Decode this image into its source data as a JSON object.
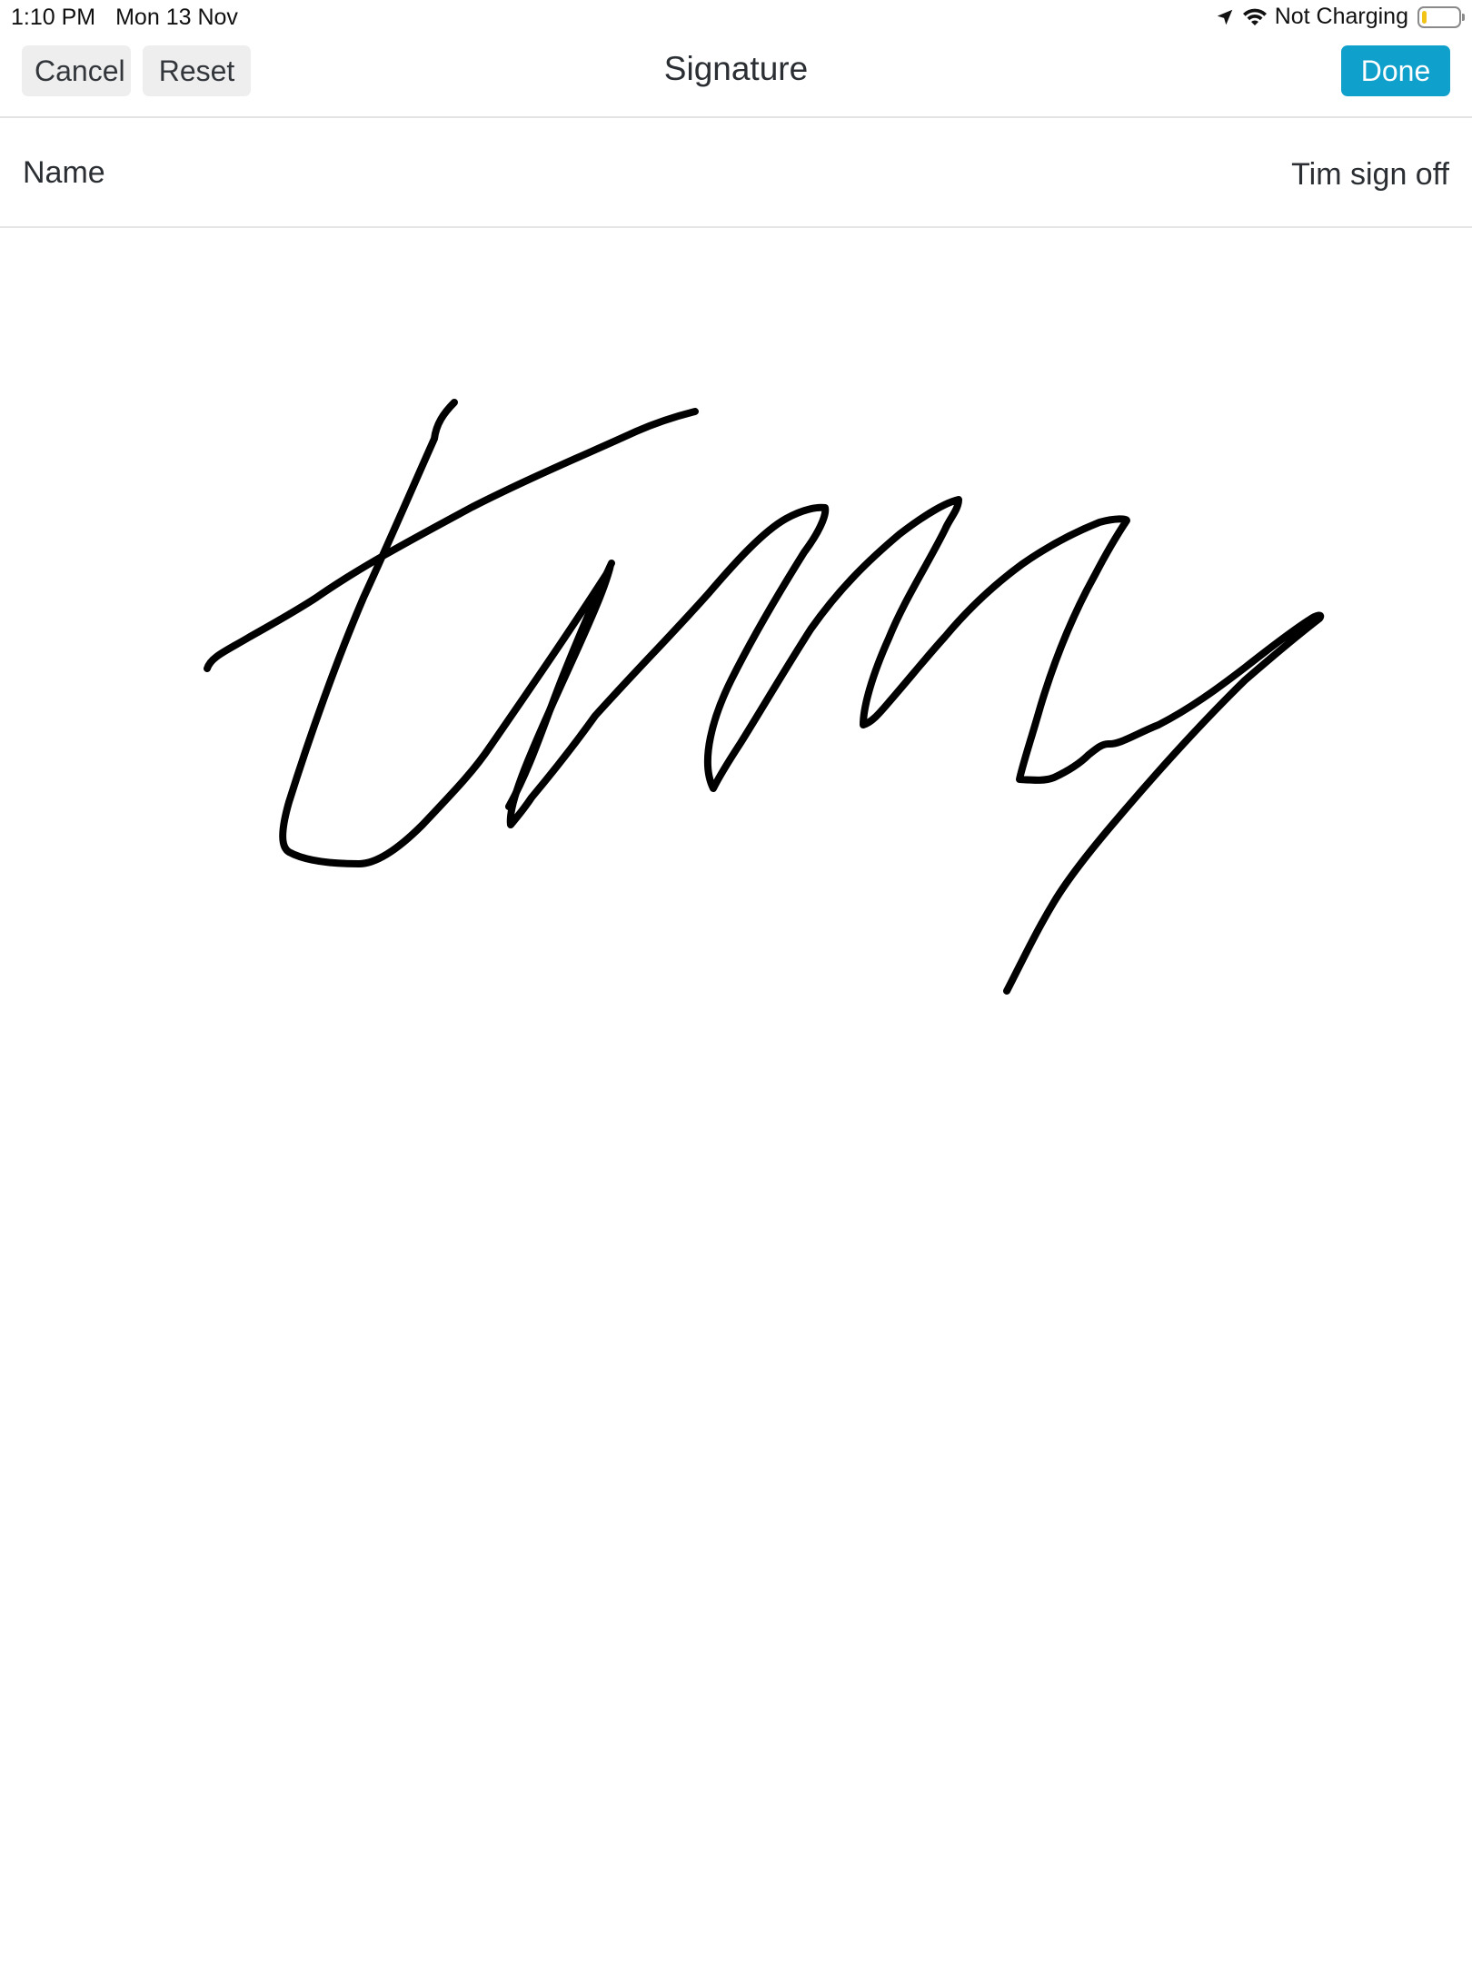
{
  "status_bar": {
    "time": "1:10 PM",
    "date": "Mon 13 Nov",
    "charging_status": "Not Charging",
    "icons": [
      "location-arrow-icon",
      "wifi-icon",
      "battery-icon"
    ],
    "battery_level_percent": 12,
    "battery_color": "#f2c319"
  },
  "nav": {
    "cancel_label": "Cancel",
    "reset_label": "Reset",
    "title": "Signature",
    "done_label": "Done",
    "done_color": "#10a0cc"
  },
  "form": {
    "name_label": "Name",
    "name_value": "Tim sign off"
  },
  "signature": {
    "stroke_color": "#000000"
  }
}
